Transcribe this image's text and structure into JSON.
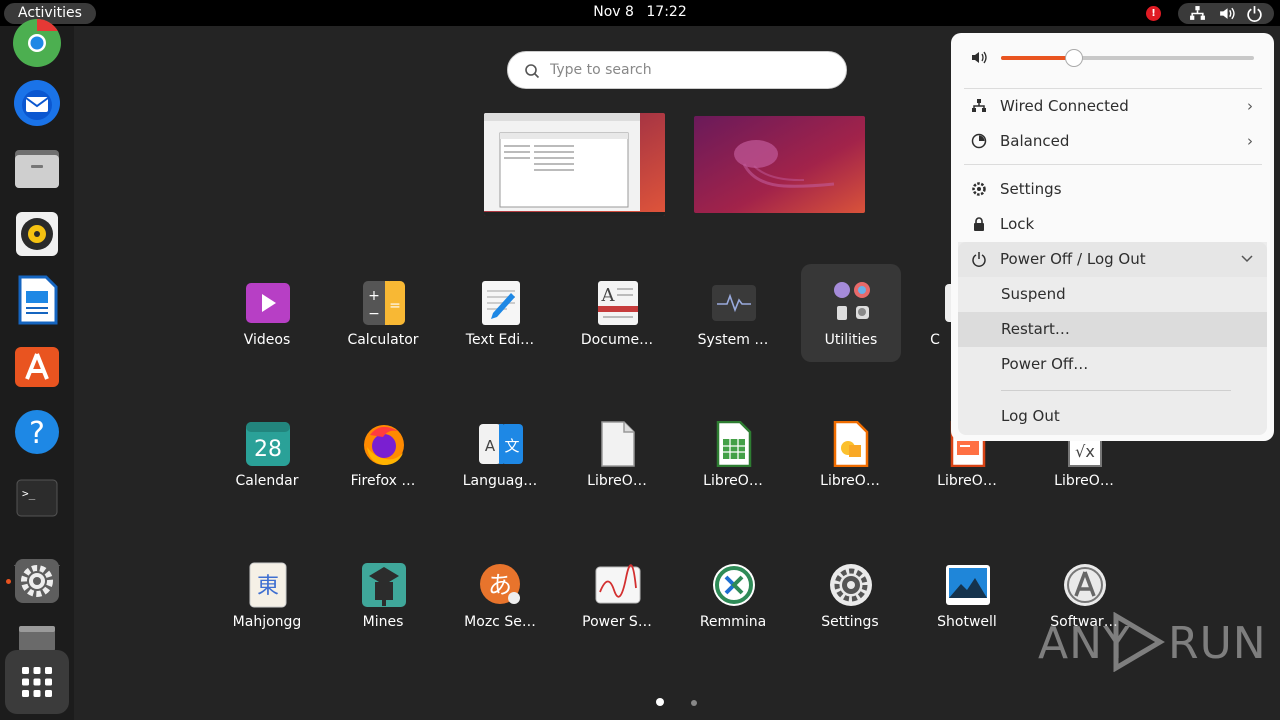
{
  "topbar": {
    "activities": "Activities",
    "date": "Nov 8",
    "time": "17:22",
    "alert_icon": "alert-icon",
    "status_icons": [
      "network-icon",
      "volume-icon",
      "power-icon"
    ]
  },
  "dock": {
    "items": [
      "chrome-icon",
      "thunderbird-icon",
      "files-icon",
      "rhythmbox-icon",
      "libreoffice-writer-icon",
      "ubuntu-software-icon",
      "help-icon",
      "terminal-icon",
      "settings-icon",
      "disk-icon"
    ],
    "show_apps": "show-applications-icon"
  },
  "search": {
    "placeholder": "Type to search"
  },
  "apps": {
    "row1": [
      {
        "label": "Videos",
        "icon": "videos-icon"
      },
      {
        "label": "Calculator",
        "icon": "calculator-icon"
      },
      {
        "label": "Text Edi…",
        "icon": "text-editor-icon"
      },
      {
        "label": "Docume…",
        "icon": "document-viewer-icon"
      },
      {
        "label": "System …",
        "icon": "system-monitor-icon"
      },
      {
        "label": "Utilities",
        "icon": "utilities-folder-icon"
      },
      {
        "label": "C",
        "icon": "partial-icon"
      }
    ],
    "row2": [
      {
        "label": "Calendar",
        "icon": "calendar-icon",
        "number": "28"
      },
      {
        "label": "Firefox …",
        "icon": "firefox-icon"
      },
      {
        "label": "Languag…",
        "icon": "language-support-icon",
        "glyphs": "A文"
      },
      {
        "label": "LibreO…",
        "icon": "libreoffice-icon"
      },
      {
        "label": "LibreO…",
        "icon": "libreoffice-calc-icon"
      },
      {
        "label": "LibreO…",
        "icon": "libreoffice-draw-icon"
      },
      {
        "label": "LibreO…",
        "icon": "libreoffice-impress-icon"
      },
      {
        "label": "LibreO…",
        "icon": "libreoffice-math-icon"
      }
    ],
    "row3": [
      {
        "label": "Mahjongg",
        "icon": "mahjongg-icon",
        "glyph": "東"
      },
      {
        "label": "Mines",
        "icon": "mines-icon"
      },
      {
        "label": "Mozc Se…",
        "icon": "mozc-icon",
        "glyph": "あ"
      },
      {
        "label": "Power S…",
        "icon": "power-statistics-icon"
      },
      {
        "label": "Remmina",
        "icon": "remmina-icon"
      },
      {
        "label": "Settings",
        "icon": "settings-gear-icon"
      },
      {
        "label": "Shotwell",
        "icon": "shotwell-icon"
      },
      {
        "label": "Softwar…",
        "icon": "software-icon"
      }
    ]
  },
  "menu": {
    "volume_level": 0.29,
    "items": {
      "network": "Wired Connected",
      "power_mode": "Balanced",
      "settings": "Settings",
      "lock": "Lock",
      "power_off_logout": "Power Off / Log Out",
      "suspend": "Suspend",
      "restart": "Restart…",
      "power_off": "Power Off…",
      "log_out": "Log Out"
    }
  },
  "colors": {
    "accent": "#e95420",
    "panel_bg": "#000000",
    "overview_bg": "#242424",
    "menu_bg": "#fafafa"
  },
  "watermark": {
    "left": "ANY",
    "right": "RUN"
  }
}
